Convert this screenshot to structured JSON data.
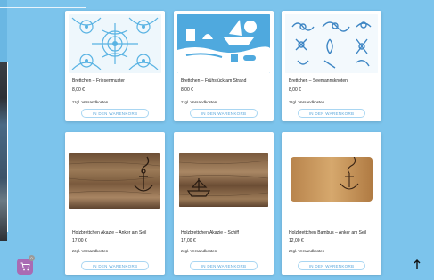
{
  "products": [
    {
      "title": "Brettchen – Friesenmuster",
      "price": "8,00 €",
      "shipping": "zzgl. Versandkosten",
      "button": "IN DEN WARENKORB"
    },
    {
      "title": "Brettchen – Frühstück am Strand",
      "price": "8,00 €",
      "shipping": "zzgl. Versandkosten",
      "button": "IN DEN WARENKORB"
    },
    {
      "title": "Brettchen – Seemannsknoten",
      "price": "8,00 €",
      "shipping": "zzgl. Versandkosten",
      "button": "IN DEN WARENKORB"
    },
    {
      "title": "Holzbrettchen Akazie – Anker am Seil",
      "price": "17,00 €",
      "shipping": "zzgl. Versandkosten",
      "button": "IN DEN WARENKORB"
    },
    {
      "title": "Holzbrettchen Akazie – Schiff",
      "price": "17,00 €",
      "shipping": "zzgl. Versandkosten",
      "button": "IN DEN WARENKORB"
    },
    {
      "title": "Holzbrettchen Bambus – Anker am Seil",
      "price": "12,00 €",
      "shipping": "zzgl. Versandkosten",
      "button": "IN DEN WARENKORB"
    }
  ],
  "cart": {
    "icon": "cart-icon",
    "count": "0"
  },
  "scroll_top": {
    "icon": "arrow-up-icon"
  },
  "colors": {
    "background": "#7cc4ec",
    "button_text": "#5aa7db",
    "cart": "#a96bb3"
  }
}
